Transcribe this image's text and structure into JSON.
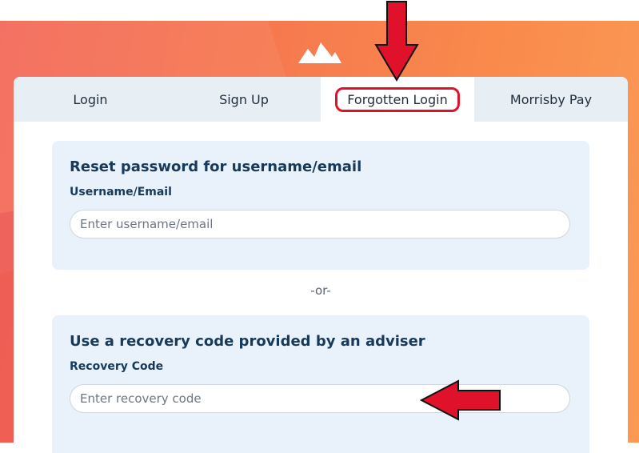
{
  "tabs": [
    {
      "label": "Login"
    },
    {
      "label": "Sign Up"
    },
    {
      "label": "Forgotten Login"
    },
    {
      "label": "Morrisby Pay"
    }
  ],
  "active_tab": "Forgotten Login",
  "reset": {
    "title": "Reset password for username/email",
    "label": "Username/Email",
    "placeholder": "Enter username/email",
    "value": ""
  },
  "separator": "-or-",
  "recovery": {
    "title": "Use a recovery code provided by an adviser",
    "label": "Recovery Code",
    "placeholder": "Enter recovery code",
    "value": ""
  },
  "colors": {
    "background_gradient_start": "#f3695a",
    "background_gradient_end": "#fb9a55",
    "tab_bar": "#e7eef4",
    "panel": "#e9f1fb",
    "heading": "#173a5a",
    "annotation_red": "#e0112b"
  },
  "icons": [
    "morrisby-logo-icon",
    "down-arrow-annotation-icon",
    "left-arrow-annotation-icon"
  ]
}
